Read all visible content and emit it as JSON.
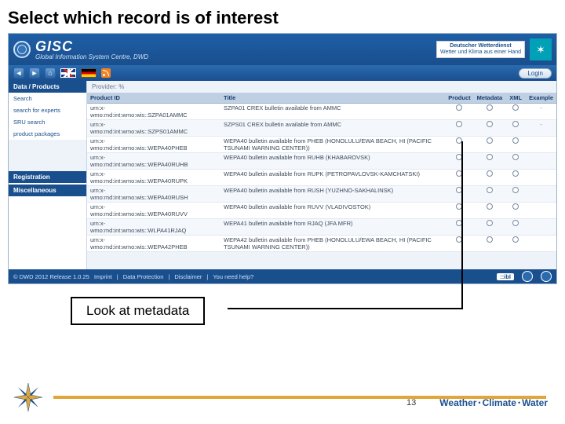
{
  "slide": {
    "title": "Select which record is of interest",
    "callout": "Look at metadata",
    "page": "13"
  },
  "brand": {
    "name": "GISC",
    "sub": "Global Information System Centre, DWD"
  },
  "dwd": {
    "line1": "Deutscher Wetterdienst",
    "line2": "Wetter und Klima aus einer Hand"
  },
  "toolbar": {
    "login": "Login"
  },
  "sidebar": {
    "h1": "Data / Products",
    "items": [
      "Search",
      "search for experts",
      "SRU search",
      "product packages"
    ],
    "h2": "Registration",
    "h3": "Miscellaneous"
  },
  "provider": "Provider: %",
  "columns": {
    "pid": "Product ID",
    "title": "Title",
    "product": "Product",
    "metadata": "Metadata",
    "xml": "XML",
    "example": "Example"
  },
  "rows": [
    {
      "pid_l1": "urn:x-",
      "pid_l2": "wmo:md:int:wmo:wis::SZPA01AMMC",
      "title": "SZPA01 CREX bulletin available from AMMC",
      "ex": "-"
    },
    {
      "pid_l1": "urn:x-",
      "pid_l2": "wmo:md:int:wmo:wis::SZPS01AMMC",
      "title": "SZPS01 CREX bulletin available from AMMC",
      "ex": "-"
    },
    {
      "pid_l1": "urn:x-",
      "pid_l2": "wmo:md:int:wmo:wis::WEPA40PHEB",
      "title": "WEPA40 bulletin available from PHEB (HONOLULU/EWA BEACH, HI (PACIFIC TSUNAMI WARNING CENTER))",
      "ex": ""
    },
    {
      "pid_l1": "urn:x-",
      "pid_l2": "wmo:md:int:wmo:wis::WEPA40RUHB",
      "title": "WEPA40 bulletin available from RUHB (KHABAROVSK)",
      "ex": ""
    },
    {
      "pid_l1": "urn:x-",
      "pid_l2": "wmo:md:int:wmo:wis::WEPA40RUPK",
      "title": "WEPA40 bulletin available from RUPK (PETROPAVLOVSK-KAMCHATSKI)",
      "ex": ""
    },
    {
      "pid_l1": "urn:x-",
      "pid_l2": "wmo:md:int:wmo:wis::WEPA40RUSH",
      "title": "WEPA40 bulletin available from RUSH (YUZHNO-SAKHALINSK)",
      "ex": ""
    },
    {
      "pid_l1": "urn:x-",
      "pid_l2": "wmo:md:int:wmo:wis::WEPA40RUVV",
      "title": "WEPA40 bulletin available from RUVV (VLADIVOSTOK)",
      "ex": ""
    },
    {
      "pid_l1": "urn:x-",
      "pid_l2": "wmo:md:int:wmo:wis::WLPA41RJAQ",
      "title": "WEPA41 bulletin available from RJAQ (JFA MFR)",
      "ex": ""
    },
    {
      "pid_l1": "urn:x-",
      "pid_l2": "wmo:md:int:wmo:wis::WEPA42PHEB",
      "title": "WEPA42 bulletin available from PHEB (HONOLULU/EWA BEACH, HI (PACIFIC TSUNAMI WARNING CENTER))",
      "ex": ""
    }
  ],
  "footer": {
    "copy": "© DWD 2012 Release 1.0.25",
    "links": [
      "Imprint",
      "Data Protection",
      "Disclaimer",
      "You need help?"
    ],
    "ibl": "::ibl"
  },
  "slidefoot": {
    "w": "Weather",
    "c": "Climate",
    "wa": "Water",
    "dot": "•"
  }
}
